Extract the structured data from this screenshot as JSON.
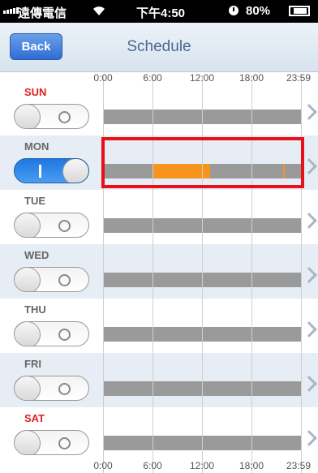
{
  "status_bar": {
    "carrier": "遠傳電信",
    "time": "下午4:50",
    "battery": "80%"
  },
  "nav": {
    "back_label": "Back",
    "title": "Schedule"
  },
  "hours": [
    "0:00",
    "6:00",
    "12:00",
    "18:00",
    "23:59"
  ],
  "days": [
    {
      "label": "SUN",
      "enabled": false,
      "segments": []
    },
    {
      "label": "MON",
      "enabled": true,
      "segments": [
        {
          "start": 6.0,
          "end": 13.0
        },
        {
          "start": 21.8,
          "end": 22.0
        }
      ]
    },
    {
      "label": "TUE",
      "enabled": false,
      "segments": []
    },
    {
      "label": "WED",
      "enabled": false,
      "segments": []
    },
    {
      "label": "THU",
      "enabled": false,
      "segments": []
    },
    {
      "label": "FRI",
      "enabled": false,
      "segments": []
    },
    {
      "label": "SAT",
      "enabled": false,
      "segments": []
    }
  ],
  "colors": {
    "weekend_label": "#e0201e",
    "active_segment": "#f7941d",
    "selection_outline": "#e8101a"
  }
}
